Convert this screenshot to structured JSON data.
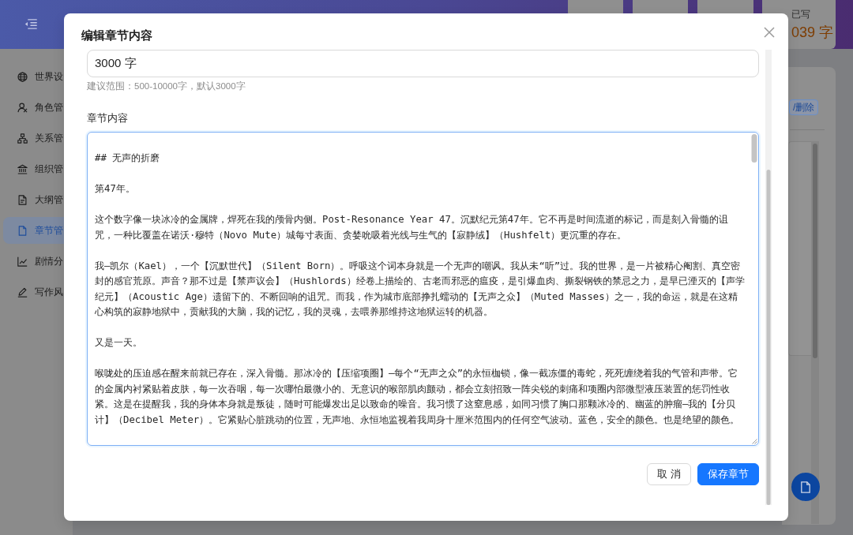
{
  "header": {
    "stat_cards": [
      {
        "label": "已写",
        "value": "039 字"
      }
    ]
  },
  "sidebar": {
    "items": [
      {
        "label": "世界设",
        "selected": false
      },
      {
        "label": "角色管",
        "selected": false
      },
      {
        "label": "关系管",
        "selected": false
      },
      {
        "label": "组织管",
        "selected": false
      },
      {
        "label": "大纲管",
        "selected": false
      },
      {
        "label": "章节管",
        "selected": true
      },
      {
        "label": "剧情分",
        "selected": false
      },
      {
        "label": "写作风",
        "selected": false
      }
    ]
  },
  "side_panel": {
    "tag": "/删除"
  },
  "dialog": {
    "title": "编辑章节内容",
    "word_count_field": {
      "value": "3000 字",
      "help": "建议范围：500-10000字，默认3000字"
    },
    "content_field": {
      "label": "章节内容",
      "paragraphs": [
        "## 无声的折磨",
        "第47年。",
        "这个数字像一块冰冷的金属牌，焊死在我的颅骨内侧。Post-Resonance Year 47。沉默纪元第47年。它不再是时间流逝的标记，而是刻入骨髓的诅咒，一种比覆盖在诺沃·穆特（Novo Mute）城每寸表面、贪婪吮吸着光线与生气的【寂静绒】（Hushfelt）更沉重的存在。",
        "我—凯尔（Kael），一个【沉默世代】（Silent Born）。呼吸这个词本身就是一个无声的嘲讽。我从未“听”过。我的世界，是一片被精心阉割、真空密封的感官荒原。声音？那不过是【禁声议会】（Hushlords）经卷上描绘的、古老而邪恶的瘟疫，是引爆血肉、撕裂钢铁的禁忌之力，是早已湮灭的【声学纪元】（Acoustic Age）遗留下的、不断回响的诅咒。而我，作为城市底部挣扎蠕动的【无声之众】（Muted Masses）之一，我的命运，就是在这精心构筑的寂静地狱中，贡献我的大脑，我的记忆，我的灵魂，去喂养那维持这地狱运转的机器。",
        "又是一天。",
        "喉咙处的压迫感在醒来前就已存在，深入骨髓。那冰冷的【压缩项圈】—每个“无声之众”的永恒枷锁，像一截冻僵的毒蛇，死死缠绕着我的气管和声带。它的金属内衬紧贴着皮肤，每一次吞咽，每一次哪怕最微小的、无意识的喉部肌肉颤动，都会立刻招致一阵尖锐的刺痛和项圈内部微型液压装置的惩罚性收紧。这是在提醒我，我的身体本身就是叛徒，随时可能爆发出足以致命的噪音。我习惯了这窒息感，如同习惯了胸口那颗冰冷的、幽蓝的肿瘤—我的【分贝计】（Decibel Meter）。它紧贴心脏跳动的位置，无声地、永恒地监视着我周身十厘米范围内的任何空气波动。蓝色，安全的颜色。也是绝望的颜色。"
      ]
    },
    "buttons": [
      {
        "label": "取 消",
        "kind": "default"
      },
      {
        "label": "保存章节",
        "kind": "primary"
      }
    ]
  }
}
